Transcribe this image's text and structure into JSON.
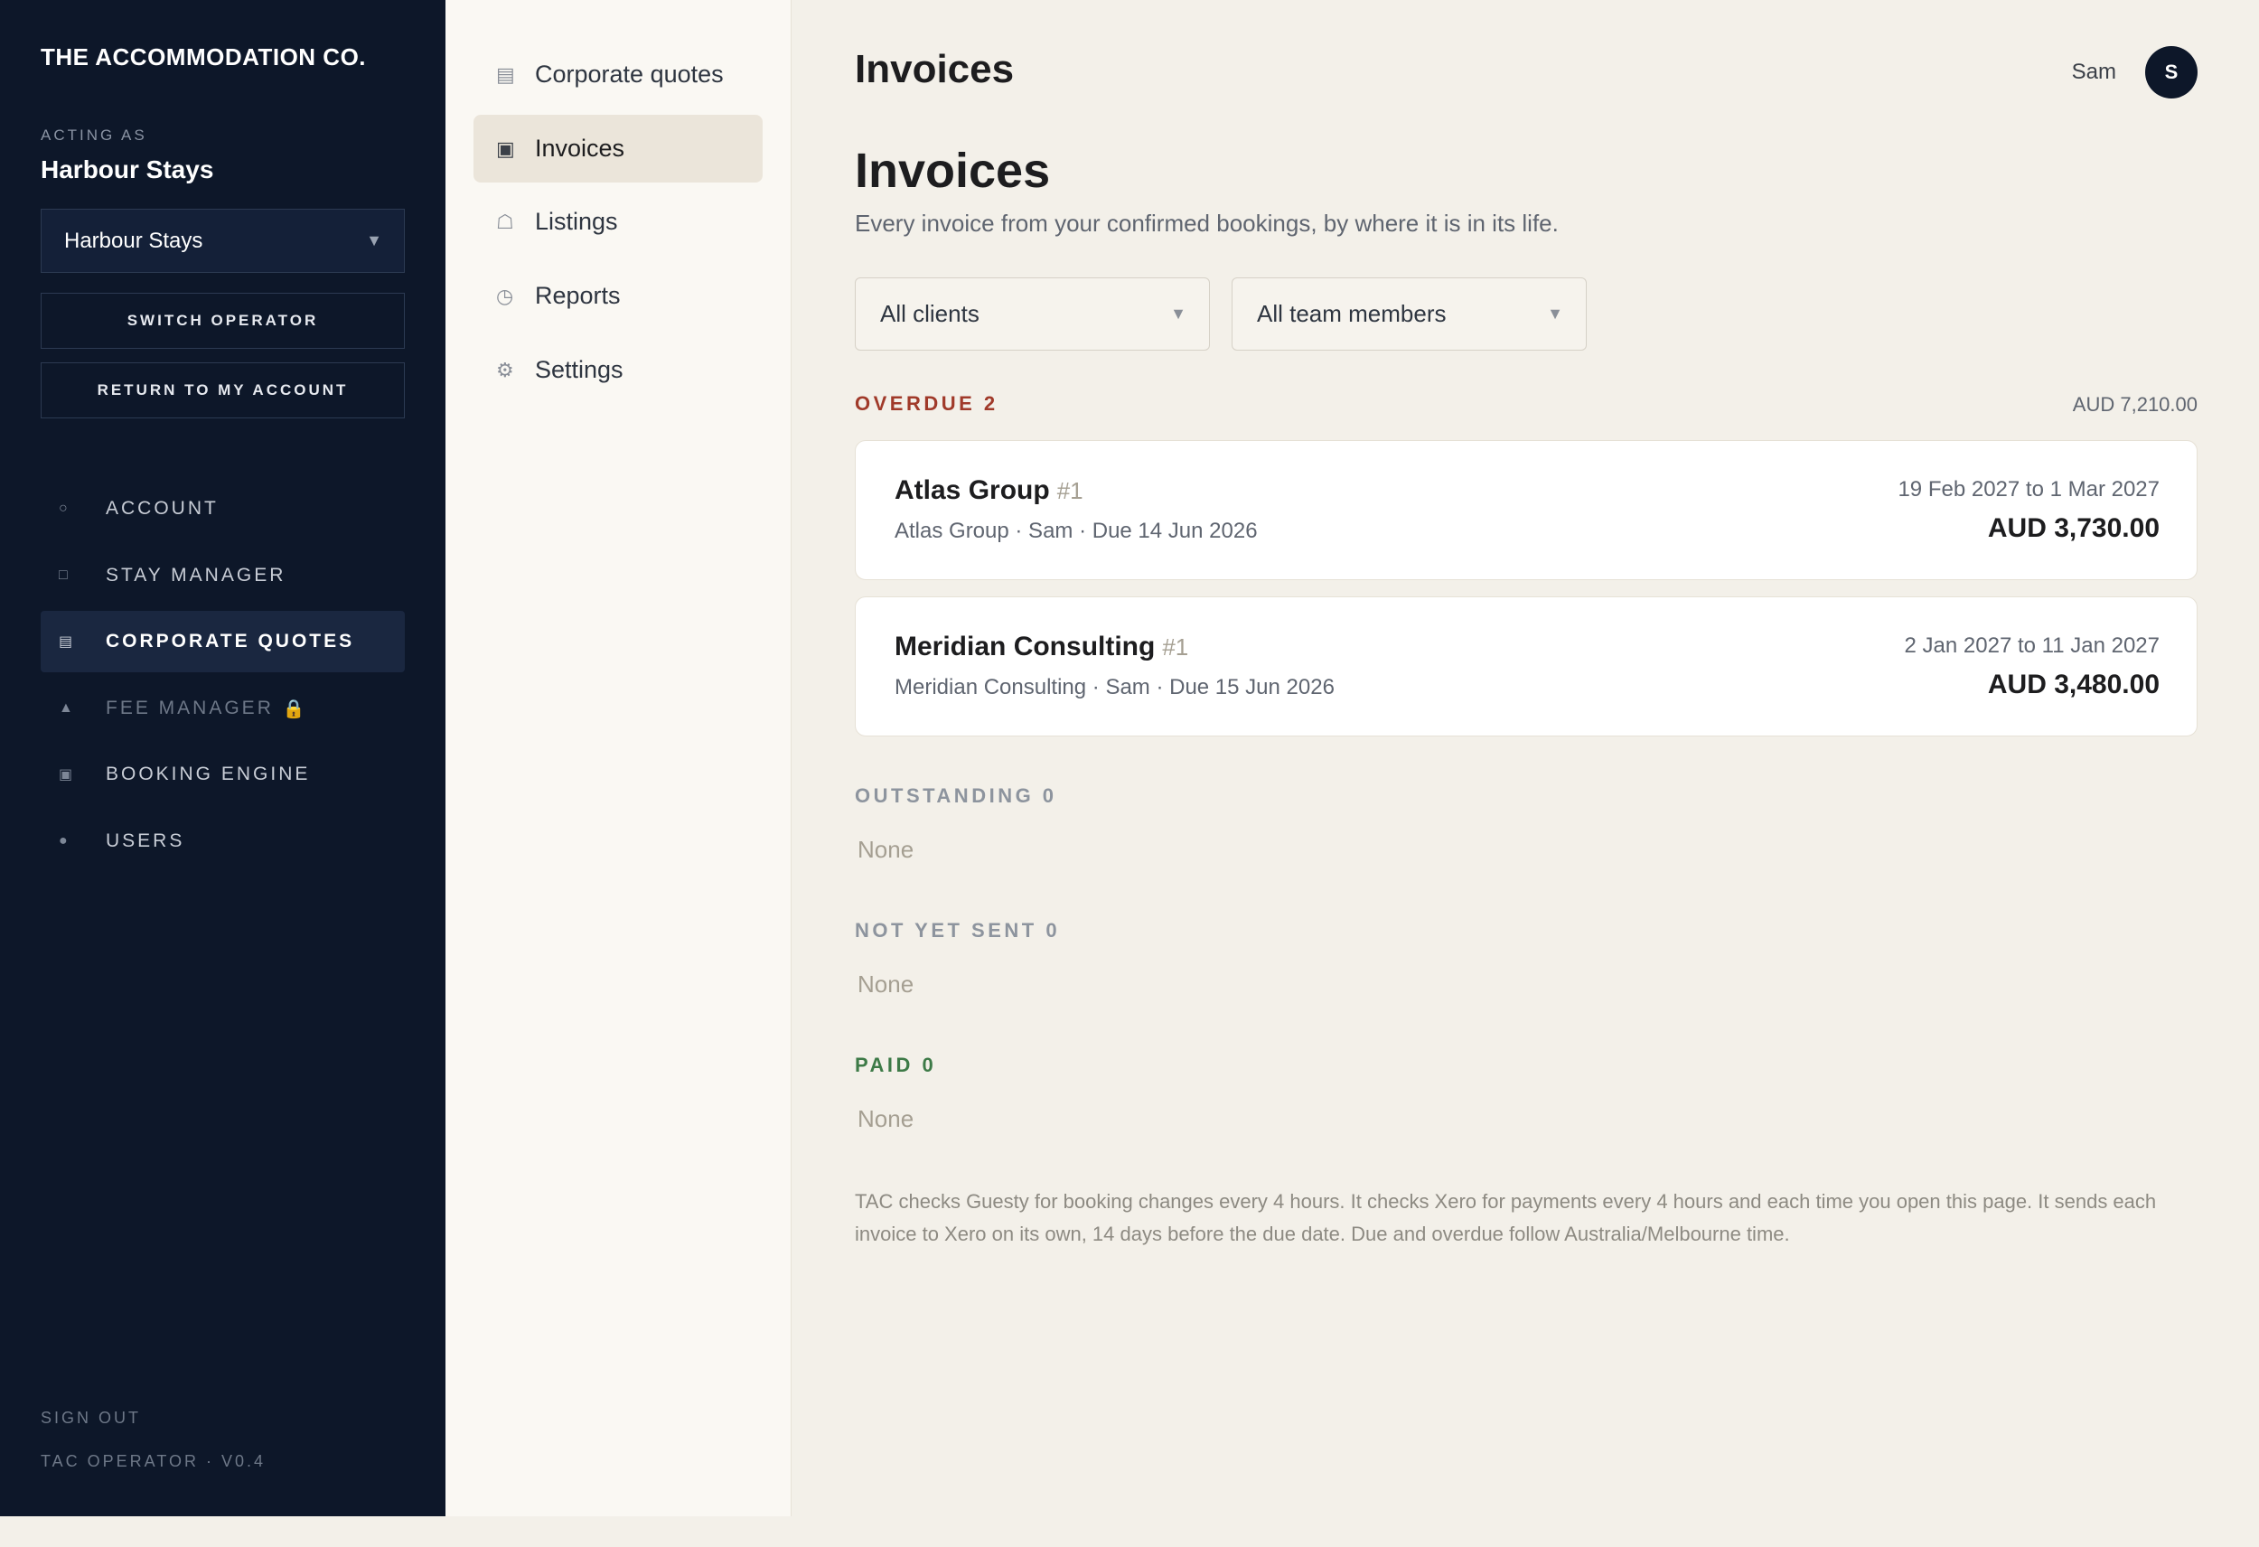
{
  "sidebar": {
    "brand": "THE ACCOMMODATION CO.",
    "acting_label": "ACTING AS",
    "acting_name": "Harbour Stays",
    "operator_select": {
      "value": "Harbour Stays",
      "caret_icon": "chevron-down-icon"
    },
    "switch_operator": "SWITCH OPERATOR",
    "return_account": "RETURN TO MY ACCOUNT",
    "items": [
      {
        "label": "ACCOUNT",
        "icon": "circle-icon",
        "glyph": "○"
      },
      {
        "label": "STAY MANAGER",
        "icon": "square-icon",
        "glyph": "□"
      },
      {
        "label": "CORPORATE QUOTES",
        "icon": "document-icon",
        "glyph": "▤",
        "active": true
      },
      {
        "label": "FEE MANAGER",
        "icon": "triangle-icon",
        "glyph": "▲",
        "locked": true,
        "lock_glyph": "🔒"
      },
      {
        "label": "BOOKING ENGINE",
        "icon": "grid-icon",
        "glyph": "▣"
      },
      {
        "label": "USERS",
        "icon": "dot-icon",
        "glyph": "●"
      }
    ],
    "sign_out": "SIGN OUT",
    "version": "TAC OPERATOR · V0.4"
  },
  "subnav": {
    "items": [
      {
        "label": "Corporate quotes",
        "icon": "document-icon",
        "glyph": "▤"
      },
      {
        "label": "Invoices",
        "icon": "invoice-icon",
        "glyph": "▣",
        "active": true
      },
      {
        "label": "Listings",
        "icon": "home-icon",
        "glyph": "☖"
      },
      {
        "label": "Reports",
        "icon": "clock-icon",
        "glyph": "◷"
      },
      {
        "label": "Settings",
        "icon": "gear-icon",
        "glyph": "⚙"
      }
    ]
  },
  "header": {
    "title": "Invoices",
    "user_name": "Sam",
    "avatar_initial": "S"
  },
  "main": {
    "title": "Invoices",
    "subtitle": "Every invoice from your confirmed bookings, by where it is in its life.",
    "filters": {
      "clients": "All clients",
      "team": "All team members"
    },
    "overdue": {
      "heading": "OVERDUE 2",
      "total": "AUD 7,210.00",
      "invoices": [
        {
          "client": "Atlas Group",
          "number": "#1",
          "meta": "Atlas Group · Sam · Due 14 Jun 2026",
          "dates": "19 Feb 2027 to 1 Mar 2027",
          "amount": "AUD 3,730.00"
        },
        {
          "client": "Meridian Consulting",
          "number": "#1",
          "meta": "Meridian Consulting · Sam · Due 15 Jun 2026",
          "dates": "2 Jan 2027 to 11 Jan 2027",
          "amount": "AUD 3,480.00"
        }
      ]
    },
    "outstanding": {
      "heading": "OUTSTANDING 0",
      "empty": "None"
    },
    "not_yet_sent": {
      "heading": "NOT YET SENT 0",
      "empty": "None"
    },
    "paid": {
      "heading": "PAID 0",
      "empty": "None"
    },
    "footnote": "TAC checks Guesty for booking changes every 4 hours. It checks Xero for payments every 4 hours and each time you open this page. It sends each invoice to Xero on its own, 14 days before the due date. Due and overdue follow Australia/Melbourne time."
  },
  "colors": {
    "sidebar_bg": "#0d1729",
    "page_bg": "#f3f0e9",
    "overdue": "#a03a2a",
    "paid": "#3d7a47"
  }
}
